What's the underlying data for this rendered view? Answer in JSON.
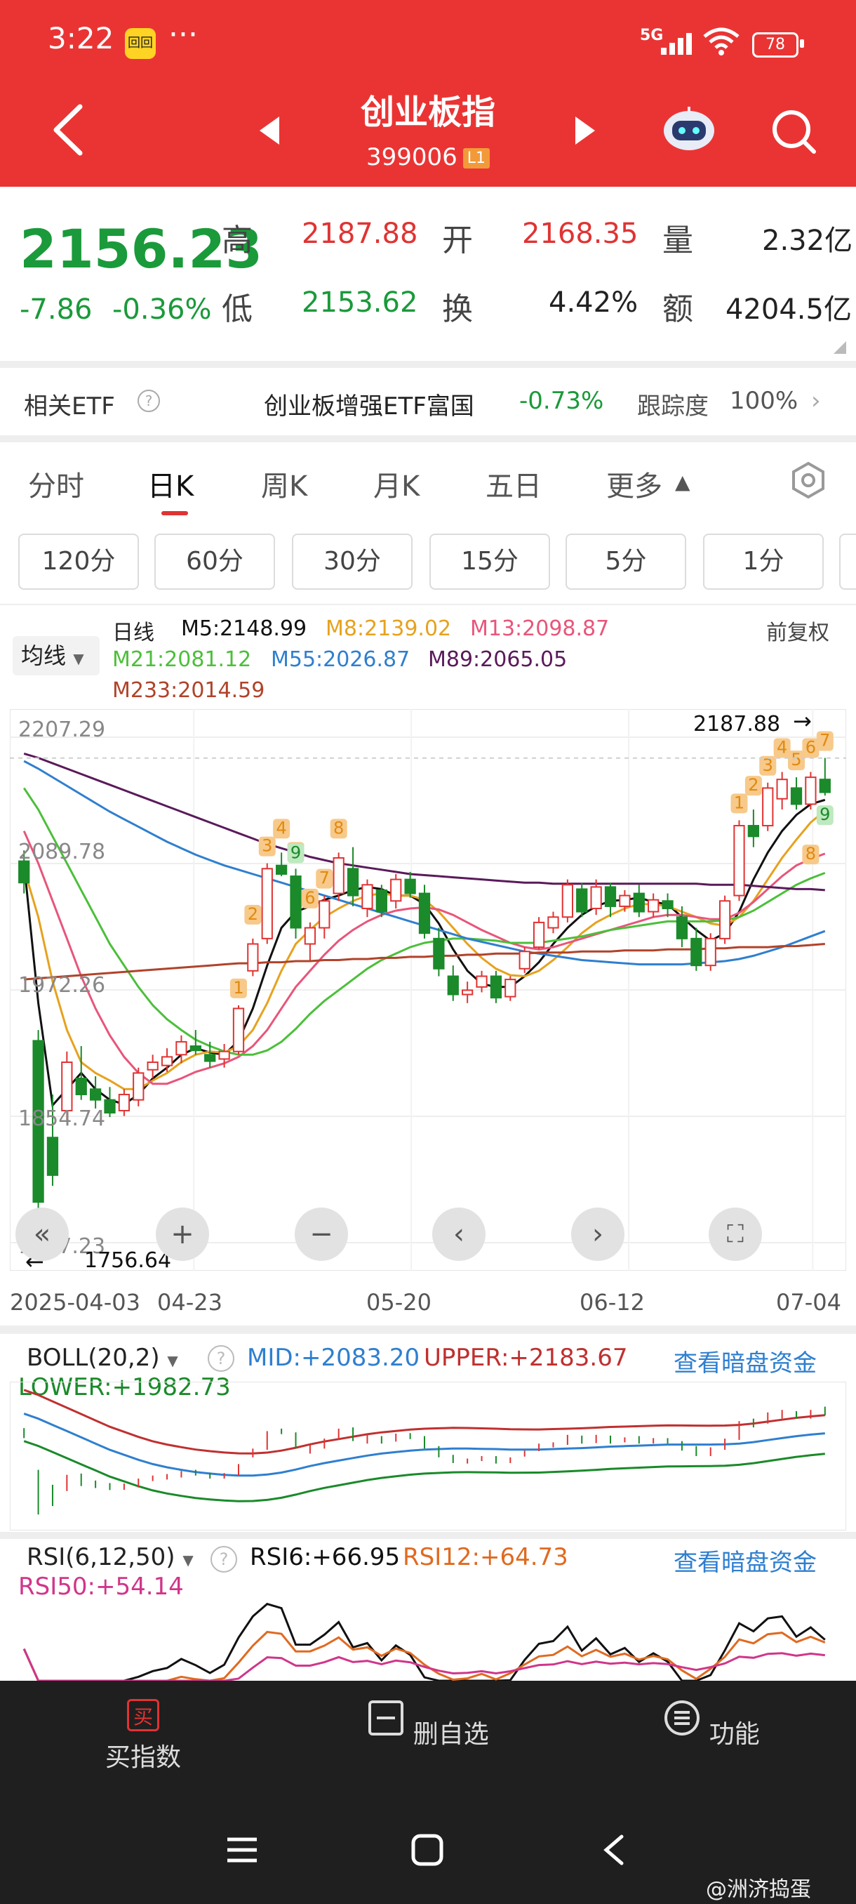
{
  "status_bar": {
    "time": "3:22",
    "more": "···",
    "network": "5G",
    "battery": "78",
    "notif": "回回"
  },
  "header": {
    "title": "创业板指",
    "code": "399006",
    "level": "L1"
  },
  "quote": {
    "price": "2156.23",
    "change_abs": "-7.86",
    "change_pct": "-0.36%",
    "high_label": "高",
    "high": "2187.88",
    "open_label": "开",
    "open": "2168.35",
    "volume_label": "量",
    "volume": "2.32亿",
    "low_label": "低",
    "low": "2153.62",
    "turnover_label": "换",
    "turnover": "4.42%",
    "amount_label": "额",
    "amount": "4204.5亿"
  },
  "etf": {
    "label": "相关ETF",
    "name": "创业板增强ETF富国",
    "change": "-0.73%",
    "tracking_label": "跟踪度",
    "tracking": "100%"
  },
  "tabs": [
    "分时",
    "日K",
    "周K",
    "月K",
    "五日",
    "更多"
  ],
  "minute_buttons": [
    "120分",
    "60分",
    "30分",
    "15分",
    "5分",
    "1分"
  ],
  "ma_legend": {
    "selector": "均线",
    "period": "日线",
    "adjust": "前复权",
    "m5": "M5:2148.99",
    "m8": "M8:2139.02",
    "m13": "M13:2098.87",
    "m21": "M21:2081.12",
    "m55": "M55:2026.87",
    "m89": "M89:2065.05",
    "m233": "M233:2014.59"
  },
  "colors": {
    "up": "#e03333",
    "down": "#1a8a2a",
    "m5": "#111111",
    "m8": "#e6a21e",
    "m13": "#e8557a",
    "m21": "#4cbf3a",
    "m55": "#2f7fcf",
    "m89": "#5a1a5a",
    "m233": "#b0432a",
    "header": "#ea3434",
    "link": "#2f7fcf"
  },
  "chart_data": {
    "type": "candlestick",
    "y_ticks": [
      "2207.29",
      "2089.78",
      "1972.26",
      "1854.74",
      "1737.23"
    ],
    "x_ticks": [
      "2025-04-03",
      "04-23",
      "05-20",
      "06-12",
      "07-04"
    ],
    "high_marker": "2187.88",
    "low_marker": "1756.64",
    "ylim": [
      1737.23,
      2207.29
    ],
    "ohlc": [
      [
        2092,
        2102,
        2062,
        2072
      ],
      [
        1925,
        1935,
        1756,
        1775
      ],
      [
        1835,
        1875,
        1790,
        1800
      ],
      [
        1860,
        1915,
        1850,
        1905
      ],
      [
        1890,
        1920,
        1870,
        1875
      ],
      [
        1880,
        1892,
        1862,
        1870
      ],
      [
        1870,
        1882,
        1854,
        1858
      ],
      [
        1860,
        1880,
        1855,
        1875
      ],
      [
        1870,
        1900,
        1864,
        1895
      ],
      [
        1898,
        1912,
        1890,
        1905
      ],
      [
        1902,
        1918,
        1896,
        1910
      ],
      [
        1912,
        1930,
        1904,
        1924
      ],
      [
        1920,
        1935,
        1912,
        1916
      ],
      [
        1912,
        1924,
        1900,
        1906
      ],
      [
        1908,
        1922,
        1900,
        1915
      ],
      [
        1915,
        1958,
        1912,
        1955
      ],
      [
        1990,
        2020,
        1985,
        2015
      ],
      [
        2020,
        2090,
        2015,
        2085
      ],
      [
        2088,
        2100,
        2078,
        2080
      ],
      [
        2078,
        2085,
        2020,
        2030
      ],
      [
        2015,
        2035,
        2000,
        2030
      ],
      [
        2030,
        2060,
        2020,
        2055
      ],
      [
        2062,
        2100,
        2055,
        2095
      ],
      [
        2085,
        2105,
        2050,
        2060
      ],
      [
        2048,
        2075,
        2040,
        2070
      ],
      [
        2065,
        2070,
        2040,
        2045
      ],
      [
        2055,
        2080,
        2048,
        2075
      ],
      [
        2075,
        2082,
        2058,
        2062
      ],
      [
        2062,
        2070,
        2020,
        2025
      ],
      [
        2020,
        2030,
        1985,
        1992
      ],
      [
        1985,
        1995,
        1962,
        1968
      ],
      [
        1968,
        1980,
        1960,
        1972
      ],
      [
        1975,
        1990,
        1970,
        1985
      ],
      [
        1985,
        1990,
        1960,
        1965
      ],
      [
        1966,
        1985,
        1962,
        1982
      ],
      [
        1992,
        2012,
        1988,
        2008
      ],
      [
        2012,
        2040,
        2010,
        2035
      ],
      [
        2030,
        2045,
        2025,
        2040
      ],
      [
        2040,
        2075,
        2035,
        2070
      ],
      [
        2066,
        2072,
        2040,
        2045
      ],
      [
        2048,
        2075,
        2042,
        2068
      ],
      [
        2068,
        2072,
        2040,
        2050
      ],
      [
        2050,
        2065,
        2045,
        2060
      ],
      [
        2062,
        2070,
        2040,
        2045
      ],
      [
        2045,
        2062,
        2040,
        2056
      ],
      [
        2055,
        2062,
        2040,
        2048
      ],
      [
        2040,
        2050,
        2012,
        2020
      ],
      [
        2020,
        2030,
        1990,
        1995
      ],
      [
        1995,
        2025,
        1990,
        2020
      ],
      [
        2020,
        2060,
        2015,
        2055
      ],
      [
        2060,
        2130,
        2055,
        2125
      ],
      [
        2125,
        2140,
        2105,
        2115
      ],
      [
        2125,
        2165,
        2120,
        2160
      ],
      [
        2150,
        2175,
        2140,
        2168
      ],
      [
        2160,
        2170,
        2140,
        2145
      ],
      [
        2145,
        2175,
        2140,
        2170
      ],
      [
        2168,
        2188,
        2153,
        2156
      ]
    ],
    "series": [
      {
        "name": "M5",
        "values": [
          2090,
          1960,
          1865,
          1880,
          1895,
          1880,
          1870,
          1866,
          1875,
          1890,
          1900,
          1912,
          1918,
          1914,
          1912,
          1925,
          1955,
          1995,
          2030,
          2045,
          2050,
          2056,
          2060,
          2065,
          2068,
          2066,
          2060,
          2060,
          2052,
          2034,
          2010,
          1990,
          1978,
          1975,
          1975,
          1985,
          1998,
          2015,
          2030,
          2042,
          2050,
          2055,
          2056,
          2058,
          2054,
          2052,
          2040,
          2028,
          2018,
          2025,
          2045,
          2075,
          2100,
          2120,
          2135,
          2145,
          2149
        ]
      },
      {
        "name": "M8",
        "values": [
          2085,
          2040,
          1980,
          1935,
          1905,
          1895,
          1888,
          1880,
          1880,
          1888,
          1895,
          1905,
          1912,
          1915,
          1914,
          1920,
          1935,
          1960,
          1990,
          2015,
          2028,
          2040,
          2048,
          2055,
          2060,
          2062,
          2060,
          2060,
          2056,
          2045,
          2030,
          2015,
          2002,
          1992,
          1986,
          1985,
          1990,
          2000,
          2012,
          2025,
          2035,
          2042,
          2048,
          2052,
          2052,
          2050,
          2045,
          2040,
          2034,
          2032,
          2040,
          2055,
          2075,
          2095,
          2112,
          2128,
          2139
        ]
      },
      {
        "name": "M13",
        "values": [
          2120,
          2090,
          2055,
          2020,
          1985,
          1955,
          1930,
          1910,
          1895,
          1885,
          1885,
          1890,
          1896,
          1900,
          1904,
          1910,
          1920,
          1935,
          1955,
          1975,
          1990,
          2005,
          2018,
          2028,
          2036,
          2042,
          2046,
          2048,
          2049,
          2047,
          2042,
          2035,
          2028,
          2022,
          2016,
          2012,
          2010,
          2012,
          2016,
          2020,
          2024,
          2028,
          2032,
          2036,
          2040,
          2042,
          2042,
          2040,
          2038,
          2038,
          2044,
          2054,
          2066,
          2078,
          2088,
          2094,
          2099
        ]
      },
      {
        "name": "M21",
        "values": [
          2160,
          2140,
          2115,
          2090,
          2065,
          2040,
          2015,
          1995,
          1975,
          1958,
          1945,
          1935,
          1926,
          1920,
          1915,
          1912,
          1912,
          1916,
          1924,
          1936,
          1950,
          1962,
          1972,
          1982,
          1992,
          2000,
          2006,
          2012,
          2016,
          2018,
          2020,
          2020,
          2019,
          2018,
          2016,
          2016,
          2016,
          2018,
          2020,
          2022,
          2025,
          2028,
          2030,
          2032,
          2034,
          2036,
          2036,
          2036,
          2036,
          2037,
          2040,
          2046,
          2054,
          2062,
          2070,
          2076,
          2081
        ]
      },
      {
        "name": "M55",
        "values": [
          2185,
          2178,
          2170,
          2162,
          2154,
          2146,
          2138,
          2131,
          2124,
          2117,
          2110,
          2104,
          2098,
          2093,
          2088,
          2084,
          2080,
          2076,
          2072,
          2068,
          2064,
          2060,
          2056,
          2052,
          2048,
          2044,
          2040,
          2036,
          2032,
          2028,
          2024,
          2020,
          2017,
          2014,
          2011,
          2008,
          2006,
          2004,
          2002,
          2000,
          1999,
          1998,
          1997,
          1996,
          1996,
          1996,
          1996,
          1997,
          1998,
          1999,
          2001,
          2004,
          2008,
          2012,
          2017,
          2022,
          2027
        ]
      },
      {
        "name": "M89",
        "values": [
          2192,
          2188,
          2183,
          2178,
          2173,
          2168,
          2163,
          2158,
          2153,
          2148,
          2143,
          2138,
          2133,
          2128,
          2123,
          2118,
          2113,
          2108,
          2104,
          2100,
          2096,
          2093,
          2090,
          2088,
          2086,
          2084,
          2082,
          2080,
          2079,
          2078,
          2077,
          2076,
          2075,
          2074,
          2073,
          2072,
          2072,
          2071,
          2071,
          2071,
          2071,
          2071,
          2071,
          2071,
          2071,
          2071,
          2071,
          2071,
          2070,
          2070,
          2070,
          2069,
          2068,
          2067,
          2066,
          2066,
          2065
        ]
      },
      {
        "name": "M233",
        "values": [
          1982,
          1983,
          1984,
          1985,
          1986,
          1987,
          1988,
          1989,
          1990,
          1991,
          1992,
          1993,
          1994,
          1995,
          1996,
          1997,
          1997,
          1998,
          1998,
          1999,
          1999,
          2000,
          2000,
          2001,
          2001,
          2002,
          2002,
          2003,
          2003,
          2004,
          2004,
          2005,
          2005,
          2006,
          2006,
          2006,
          2007,
          2007,
          2007,
          2008,
          2008,
          2008,
          2009,
          2009,
          2009,
          2010,
          2010,
          2010,
          2011,
          2011,
          2012,
          2012,
          2012,
          2013,
          2013,
          2014,
          2015
        ]
      }
    ],
    "td_labels_top": [
      "1",
      "2",
      "3",
      "4",
      "5",
      "6",
      "7",
      "8",
      "1",
      "2",
      "3",
      "4",
      "5",
      "6",
      "7"
    ],
    "td_labels_bottom": [
      "9",
      "9",
      "8"
    ]
  },
  "chart_controls": [
    "«",
    "+",
    "−",
    "‹",
    "›",
    "⛶"
  ],
  "boll": {
    "selector": "BOLL(20,2)",
    "help": "?",
    "mid": "MID:+2083.20",
    "upper": "UPPER:+2183.67",
    "lower": "LOWER:+1982.73",
    "link": "查看暗盘资金"
  },
  "rsi": {
    "selector": "RSI(6,12,50)",
    "help": "?",
    "rsi6": "RSI6:+66.95",
    "rsi12": "RSI12:+64.73",
    "rsi50": "RSI50:+54.14",
    "link": "查看暗盘资金"
  },
  "bottom_nav": {
    "buy": "买指数",
    "buy_icon": "买",
    "remove": "删自选",
    "func": "功能"
  },
  "watermark": "@洲济捣蛋"
}
